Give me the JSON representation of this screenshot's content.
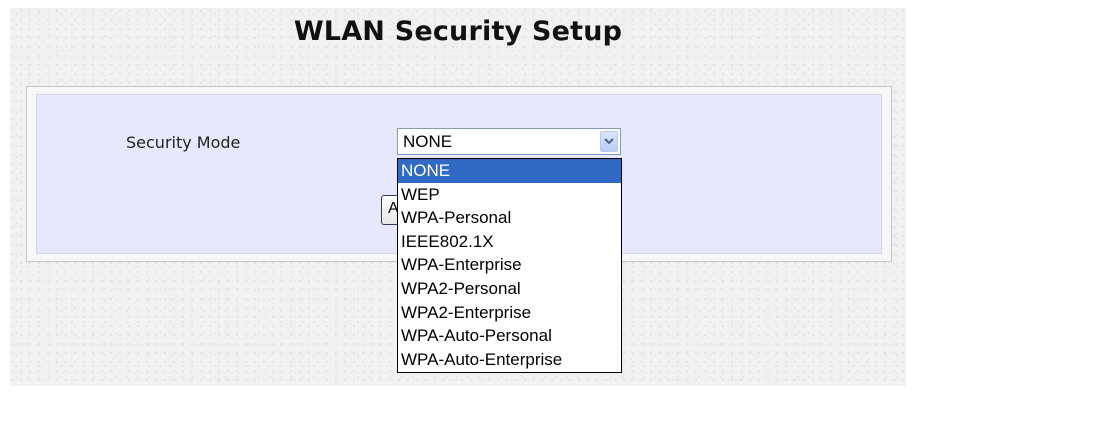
{
  "page": {
    "title": "WLAN Security Setup"
  },
  "form": {
    "security_mode_label": "Security Mode",
    "security_mode_value": "NONE",
    "apply_button_label": "Apply"
  },
  "dropdown": {
    "selected_index": 0,
    "options": [
      "NONE",
      "WEP",
      "WPA-Personal",
      "IEEE802.1X",
      "WPA-Enterprise",
      "WPA2-Personal",
      "WPA2-Enterprise",
      "WPA-Auto-Personal",
      "WPA-Auto-Enterprise"
    ]
  },
  "colors": {
    "panel_background": "#e7e8fb",
    "highlight": "#316ac5"
  },
  "icons": {
    "dropdown_arrow": "chevron-down-icon"
  }
}
